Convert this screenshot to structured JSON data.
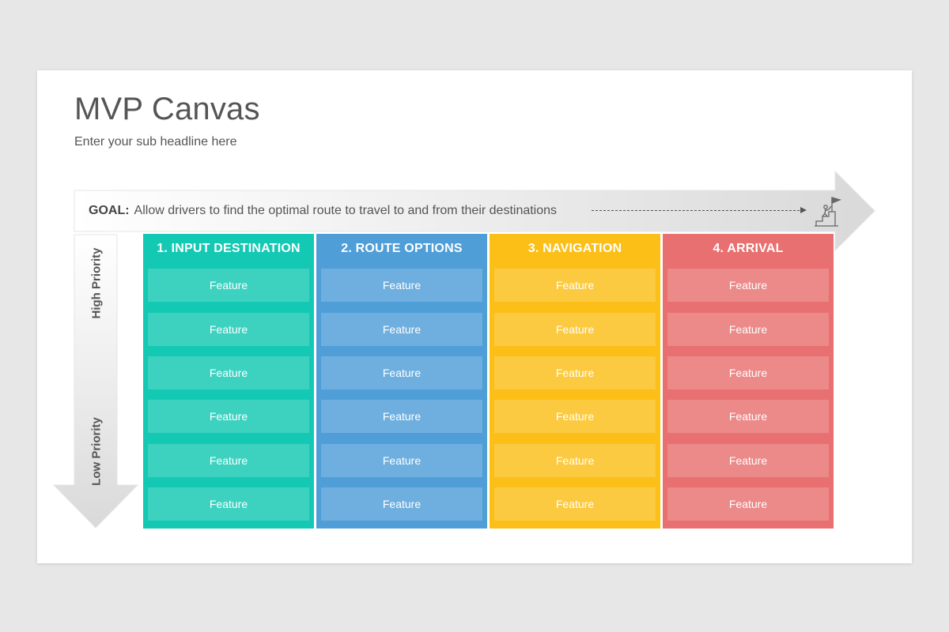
{
  "title": "MVP Canvas",
  "subtitle": "Enter your sub headline here",
  "goal": {
    "label": "GOAL:",
    "text": "Allow drivers to find the optimal route to travel to and from their destinations",
    "icon": "goal-flag-icon"
  },
  "priority": {
    "high": "High Priority",
    "low": "Low Priority"
  },
  "columns": [
    {
      "title": "1. INPUT DESTINATION",
      "color": "#13c9b3",
      "features": [
        "Feature",
        "Feature",
        "Feature",
        "Feature",
        "Feature",
        "Feature"
      ]
    },
    {
      "title": "2. ROUTE OPTIONS",
      "color": "#4f9ed8",
      "features": [
        "Feature",
        "Feature",
        "Feature",
        "Feature",
        "Feature",
        "Feature"
      ]
    },
    {
      "title": "3. NAVIGATION",
      "color": "#fbbf17",
      "features": [
        "Feature",
        "Feature",
        "Feature",
        "Feature",
        "Feature",
        "Feature"
      ]
    },
    {
      "title": "4. ARRIVAL",
      "color": "#e87070",
      "features": [
        "Feature",
        "Feature",
        "Feature",
        "Feature",
        "Feature",
        "Feature"
      ]
    }
  ]
}
